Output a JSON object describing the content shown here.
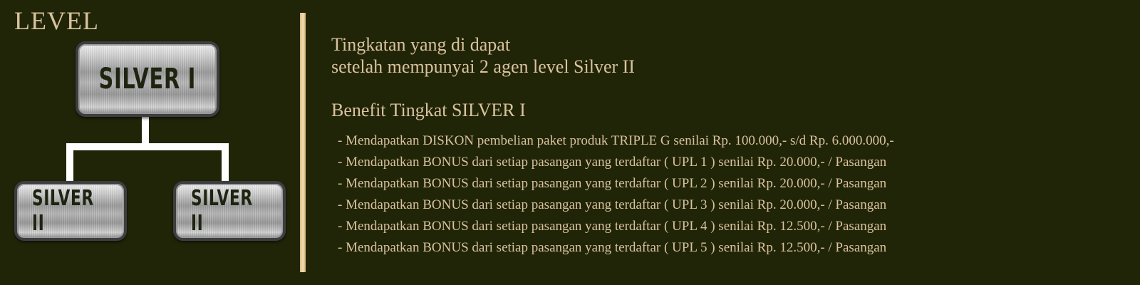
{
  "level_title": "LEVEL",
  "hierarchy": {
    "top": "SILVER I",
    "children": [
      "SILVER II",
      "SILVER II"
    ]
  },
  "description": {
    "line1": "Tingkatan yang di dapat",
    "line2": "setelah mempunyai 2 agen level Silver II"
  },
  "benefit_title": "Benefit Tingkat SILVER I",
  "benefits": [
    "- Mendapatkan DISKON pembelian paket produk TRIPLE G  senilai Rp. 100.000,- s/d Rp. 6.000.000,-",
    "- Mendapatkan BONUS dari setiap pasangan yang terdaftar ( UPL 1 ) senilai Rp. 20.000,- / Pasangan",
    "- Mendapatkan BONUS dari setiap pasangan yang terdaftar ( UPL 2 ) senilai Rp. 20.000,- / Pasangan",
    "- Mendapatkan BONUS dari setiap pasangan yang terdaftar ( UPL 3 ) senilai Rp. 20.000,- / Pasangan",
    "- Mendapatkan BONUS dari setiap pasangan yang terdaftar ( UPL 4 ) senilai Rp. 12.500,- / Pasangan",
    "- Mendapatkan BONUS dari setiap pasangan yang terdaftar ( UPL 5 ) senilai Rp. 12.500,- / Pasangan"
  ],
  "colors": {
    "background": "#212508",
    "text": "#d9c29e",
    "divider": "#e8cd98",
    "badge_text": "#1e2410"
  }
}
